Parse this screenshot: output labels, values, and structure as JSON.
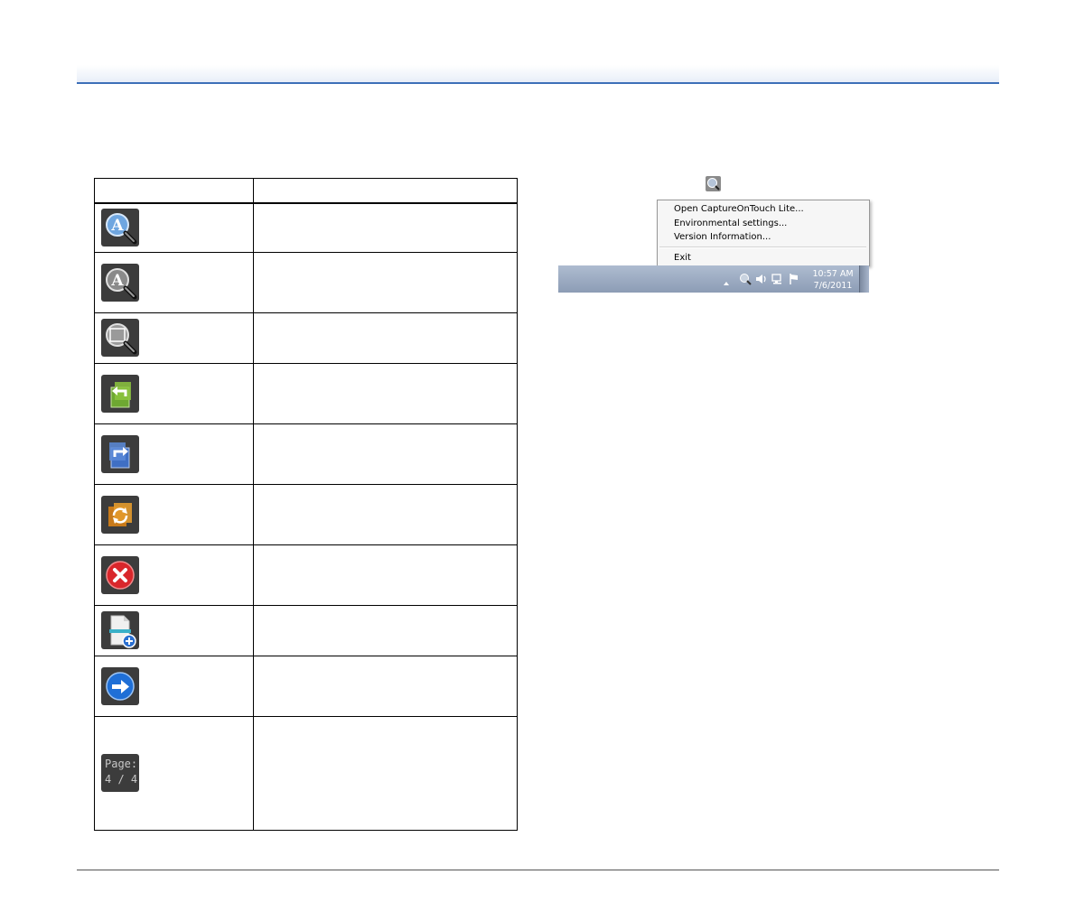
{
  "table": {
    "header": [
      "",
      ""
    ],
    "rows": [
      {
        "icon": "zoom-in-icon",
        "description": ""
      },
      {
        "icon": "zoom-out-icon",
        "description": ""
      },
      {
        "icon": "fit-to-page-icon",
        "description": ""
      },
      {
        "icon": "rotate-left-icon",
        "description": ""
      },
      {
        "icon": "rotate-right-icon",
        "description": ""
      },
      {
        "icon": "rotate-180-icon",
        "description": ""
      },
      {
        "icon": "delete-page-icon",
        "description": ""
      },
      {
        "icon": "continue-scan-icon",
        "description": ""
      },
      {
        "icon": "next-step-icon",
        "description": ""
      },
      {
        "icon": "page-counter",
        "page_label": "Page:",
        "page_value": "4 / 4",
        "description": ""
      }
    ]
  },
  "tray_menu": {
    "items": [
      "Open CaptureOnTouch Lite...",
      "Environmental settings...",
      "Version Information...",
      "Exit"
    ]
  },
  "taskbar": {
    "time": "10:57 AM",
    "date": "7/6/2011"
  },
  "colors": {
    "header_rule": "#3d6fb8",
    "icon_tile": "#3a3a3a",
    "taskbar": "#9aaac2"
  }
}
